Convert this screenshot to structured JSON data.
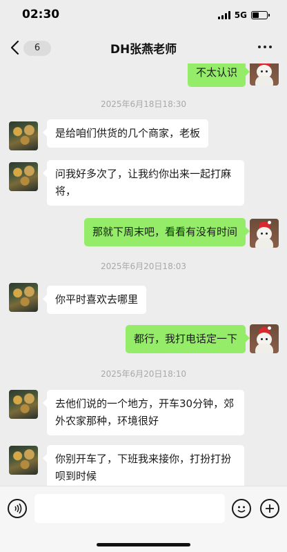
{
  "status_bar": {
    "time": "02:30",
    "network": "5G",
    "battery_level": 0.45
  },
  "header": {
    "back_icon": "chevron-left-icon",
    "unread_count": "6",
    "title": "DH张燕老师",
    "more_icon": "more-dots-icon"
  },
  "messages": [
    {
      "side": "right",
      "text": "不太认识"
    },
    {
      "timestamp": "2025年6月18日18:30"
    },
    {
      "side": "left",
      "text": "是给咱们供货的几个商家，老板"
    },
    {
      "side": "left",
      "text": "问我好多次了，让我约你出来一起打麻将，"
    },
    {
      "side": "right",
      "text": "那就下周末吧，看看有没有时间"
    },
    {
      "timestamp": "2025年6月20日18:03"
    },
    {
      "side": "left",
      "text": "你平时喜欢去哪里"
    },
    {
      "side": "right",
      "text": "都行，我打电话定一下"
    },
    {
      "timestamp": "2025年6月20日18:10"
    },
    {
      "side": "left",
      "text": "去他们说的一个地方，开车30分钟，郊外农家那种，环境很好"
    },
    {
      "side": "left",
      "text": "你别开车了，下班我来接你，打扮打扮呗到时候"
    }
  ],
  "input_bar": {
    "voice_icon": "voice-icon",
    "input_value": "",
    "emoji_icon": "emoji-icon",
    "plus_icon": "plus-icon"
  },
  "colors": {
    "background": "#ededed",
    "bubble_self": "#95ec69",
    "bubble_other": "#ffffff",
    "timestamp": "#a8a8a8"
  }
}
